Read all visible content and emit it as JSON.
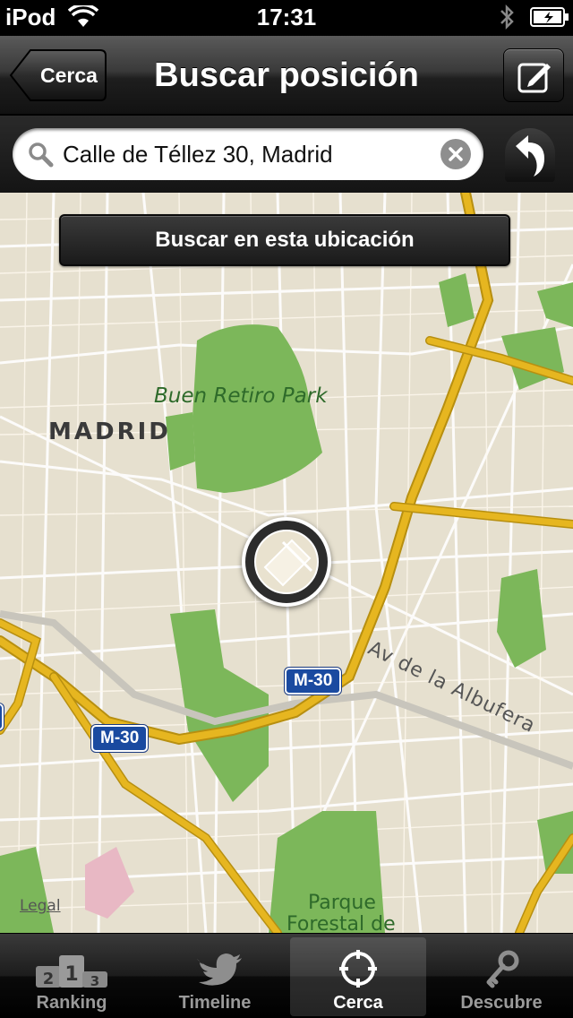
{
  "status_bar": {
    "carrier": "iPod",
    "time": "17:31"
  },
  "nav": {
    "back_label": "Cerca",
    "title": "Buscar posición"
  },
  "search": {
    "value": "Calle de Téllez 30, Madrid"
  },
  "map": {
    "search_here_label": "Buscar en esta ubicación",
    "labels": {
      "city": "MADRID",
      "park": "Buen Retiro Park",
      "parque_line1": "Parque",
      "parque_line2": "Forestal de",
      "street": "Av de la Albufera",
      "legal": "Legal"
    },
    "shields": [
      "M-30",
      "M-30"
    ]
  },
  "tabs": [
    {
      "label": "Ranking",
      "icon": "ranking-podium-icon",
      "active": false
    },
    {
      "label": "Timeline",
      "icon": "twitter-bird-icon",
      "active": false
    },
    {
      "label": "Cerca",
      "icon": "crosshair-icon",
      "active": true
    },
    {
      "label": "Descubre",
      "icon": "key-icon",
      "active": false
    }
  ],
  "colors": {
    "road_major": "#e6b620",
    "park": "#7cb75a",
    "map_bg": "#e6e0cf",
    "shield": "#1a4aa0"
  }
}
